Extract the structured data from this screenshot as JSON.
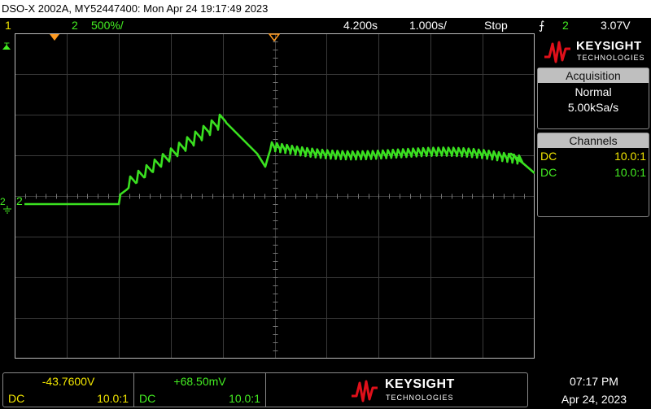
{
  "title_bar": "DSO-X 2002A, MY52447400: Mon Apr 24 19:17:49 2023",
  "status": {
    "ch1_label": "1",
    "ch2_label": "2",
    "ch2_scale": "500%/",
    "time_delay": "4.200s",
    "time_scale": "1.000s/",
    "run_state": "Stop",
    "trigger_channel": "2",
    "trigger_level": "3.07V"
  },
  "markers": {
    "trigger_level_marker": "T",
    "ch2_ground_marker": "2",
    "ch2_tag": "2"
  },
  "brand": {
    "name": "KEYSIGHT",
    "sub": "TECHNOLOGIES"
  },
  "acquisition": {
    "header": "Acquisition",
    "mode": "Normal",
    "rate": "5.00kSa/s"
  },
  "channels": {
    "header": "Channels",
    "rows": [
      {
        "coupling": "DC",
        "ratio": "10.0:1",
        "color": "#f2e600"
      },
      {
        "coupling": "DC",
        "ratio": "10.0:1",
        "color": "#44ee22"
      }
    ]
  },
  "bottom": {
    "ch1": {
      "offset": "-43.7600V",
      "coupling": "DC",
      "ratio": "10.0:1"
    },
    "ch2": {
      "offset": "+68.50mV",
      "coupling": "DC",
      "ratio": "10.0:1"
    }
  },
  "clock": {
    "time": "07:17 PM",
    "date": "Apr 24, 2023"
  },
  "colors": {
    "ch1": "#f2e600",
    "ch2": "#44ee22",
    "trigger_marker": "#ff9a20",
    "brand_red": "#e0101a"
  }
}
